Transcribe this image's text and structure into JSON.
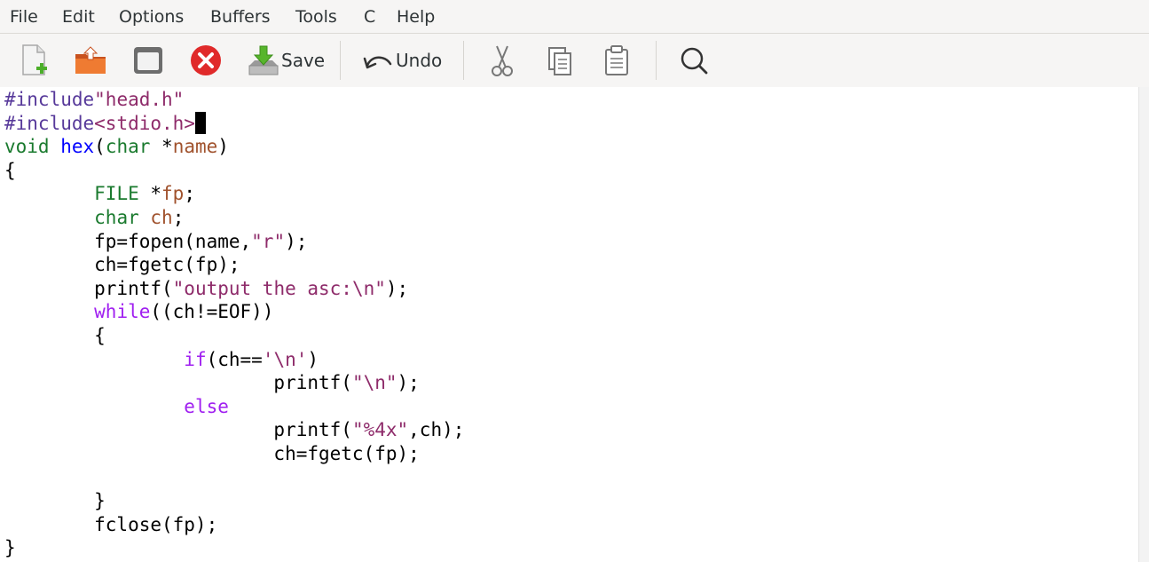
{
  "menu": [
    "File",
    "Edit",
    "Options",
    "Buffers",
    "Tools",
    "C",
    "Help"
  ],
  "toolbar": {
    "save_label": "Save",
    "undo_label": "Undo"
  },
  "code_lines": [
    [
      [
        "pp",
        "#include"
      ],
      [
        "str",
        "\"head.h\""
      ]
    ],
    [
      [
        "pp",
        "#include"
      ],
      [
        "str",
        "<stdio.h>"
      ]
    ],
    [
      [
        "type",
        "void"
      ],
      [
        "plain",
        " "
      ],
      [
        "fn",
        "hex"
      ],
      [
        "plain",
        "("
      ],
      [
        "type",
        "char"
      ],
      [
        "plain",
        " *"
      ],
      [
        "var",
        "name"
      ],
      [
        "plain",
        ")"
      ]
    ],
    [
      [
        "plain",
        "{"
      ]
    ],
    [
      [
        "plain",
        "        "
      ],
      [
        "type",
        "FILE"
      ],
      [
        "plain",
        " *"
      ],
      [
        "var",
        "fp"
      ],
      [
        "plain",
        ";"
      ]
    ],
    [
      [
        "plain",
        "        "
      ],
      [
        "type",
        "char"
      ],
      [
        "plain",
        " "
      ],
      [
        "var",
        "ch"
      ],
      [
        "plain",
        ";"
      ]
    ],
    [
      [
        "plain",
        "        fp=fopen(name,"
      ],
      [
        "str",
        "\"r\""
      ],
      [
        "plain",
        ");"
      ]
    ],
    [
      [
        "plain",
        "        ch=fgetc(fp);"
      ]
    ],
    [
      [
        "plain",
        "        printf("
      ],
      [
        "str",
        "\"output the asc:\\n\""
      ],
      [
        "plain",
        ");"
      ]
    ],
    [
      [
        "plain",
        "        "
      ],
      [
        "kw",
        "while"
      ],
      [
        "plain",
        "((ch!=EOF))"
      ]
    ],
    [
      [
        "plain",
        "        {"
      ]
    ],
    [
      [
        "plain",
        "                "
      ],
      [
        "kw",
        "if"
      ],
      [
        "plain",
        "(ch=="
      ],
      [
        "str",
        "'\\n'"
      ],
      [
        "plain",
        ")"
      ]
    ],
    [
      [
        "plain",
        "                        printf("
      ],
      [
        "str",
        "\"\\n\""
      ],
      [
        "plain",
        ");"
      ]
    ],
    [
      [
        "plain",
        "                "
      ],
      [
        "kw",
        "else"
      ]
    ],
    [
      [
        "plain",
        "                        printf("
      ],
      [
        "str",
        "\"%4x\""
      ],
      [
        "plain",
        ",ch);"
      ]
    ],
    [
      [
        "plain",
        "                        ch=fgetc(fp);"
      ]
    ],
    [
      [
        "plain",
        ""
      ]
    ],
    [
      [
        "plain",
        "        }"
      ]
    ],
    [
      [
        "plain",
        "        fclose(fp);"
      ]
    ],
    [
      [
        "plain",
        "}"
      ]
    ]
  ],
  "cursor_line": 1
}
